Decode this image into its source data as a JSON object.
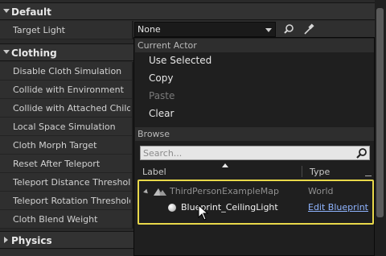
{
  "sections": {
    "default": {
      "title": "Default"
    },
    "clothing": {
      "title": "Clothing"
    },
    "physics": {
      "title": "Physics"
    }
  },
  "target_light": {
    "label": "Target Light",
    "value": "None",
    "icons": [
      "magnifier-icon",
      "eyedropper-icon"
    ]
  },
  "clothing_props": [
    "Disable Cloth Simulation",
    "Collide with Environment",
    "Collide with Attached Children",
    "Local Space Simulation",
    "Cloth Morph Target",
    "Reset After Teleport",
    "Teleport Distance Threshold",
    "Teleport Rotation Threshold",
    "Cloth Blend Weight"
  ],
  "menu": {
    "current_actor_heading": "Current Actor",
    "items": [
      "Use Selected",
      "Copy",
      "Paste",
      "Clear"
    ],
    "disabled": [
      "Paste"
    ],
    "browse_heading": "Browse",
    "search_placeholder": "Search...",
    "columns": {
      "label": "Label",
      "type": "Type"
    },
    "tree": [
      {
        "label": "ThirdPersonExampleMap",
        "type": "World"
      },
      {
        "label": "Blueprint_CeilingLight",
        "type": "Edit Blueprint"
      }
    ]
  },
  "colors": {
    "highlight_border": "#e8d84a",
    "link": "#8fb4ff"
  }
}
